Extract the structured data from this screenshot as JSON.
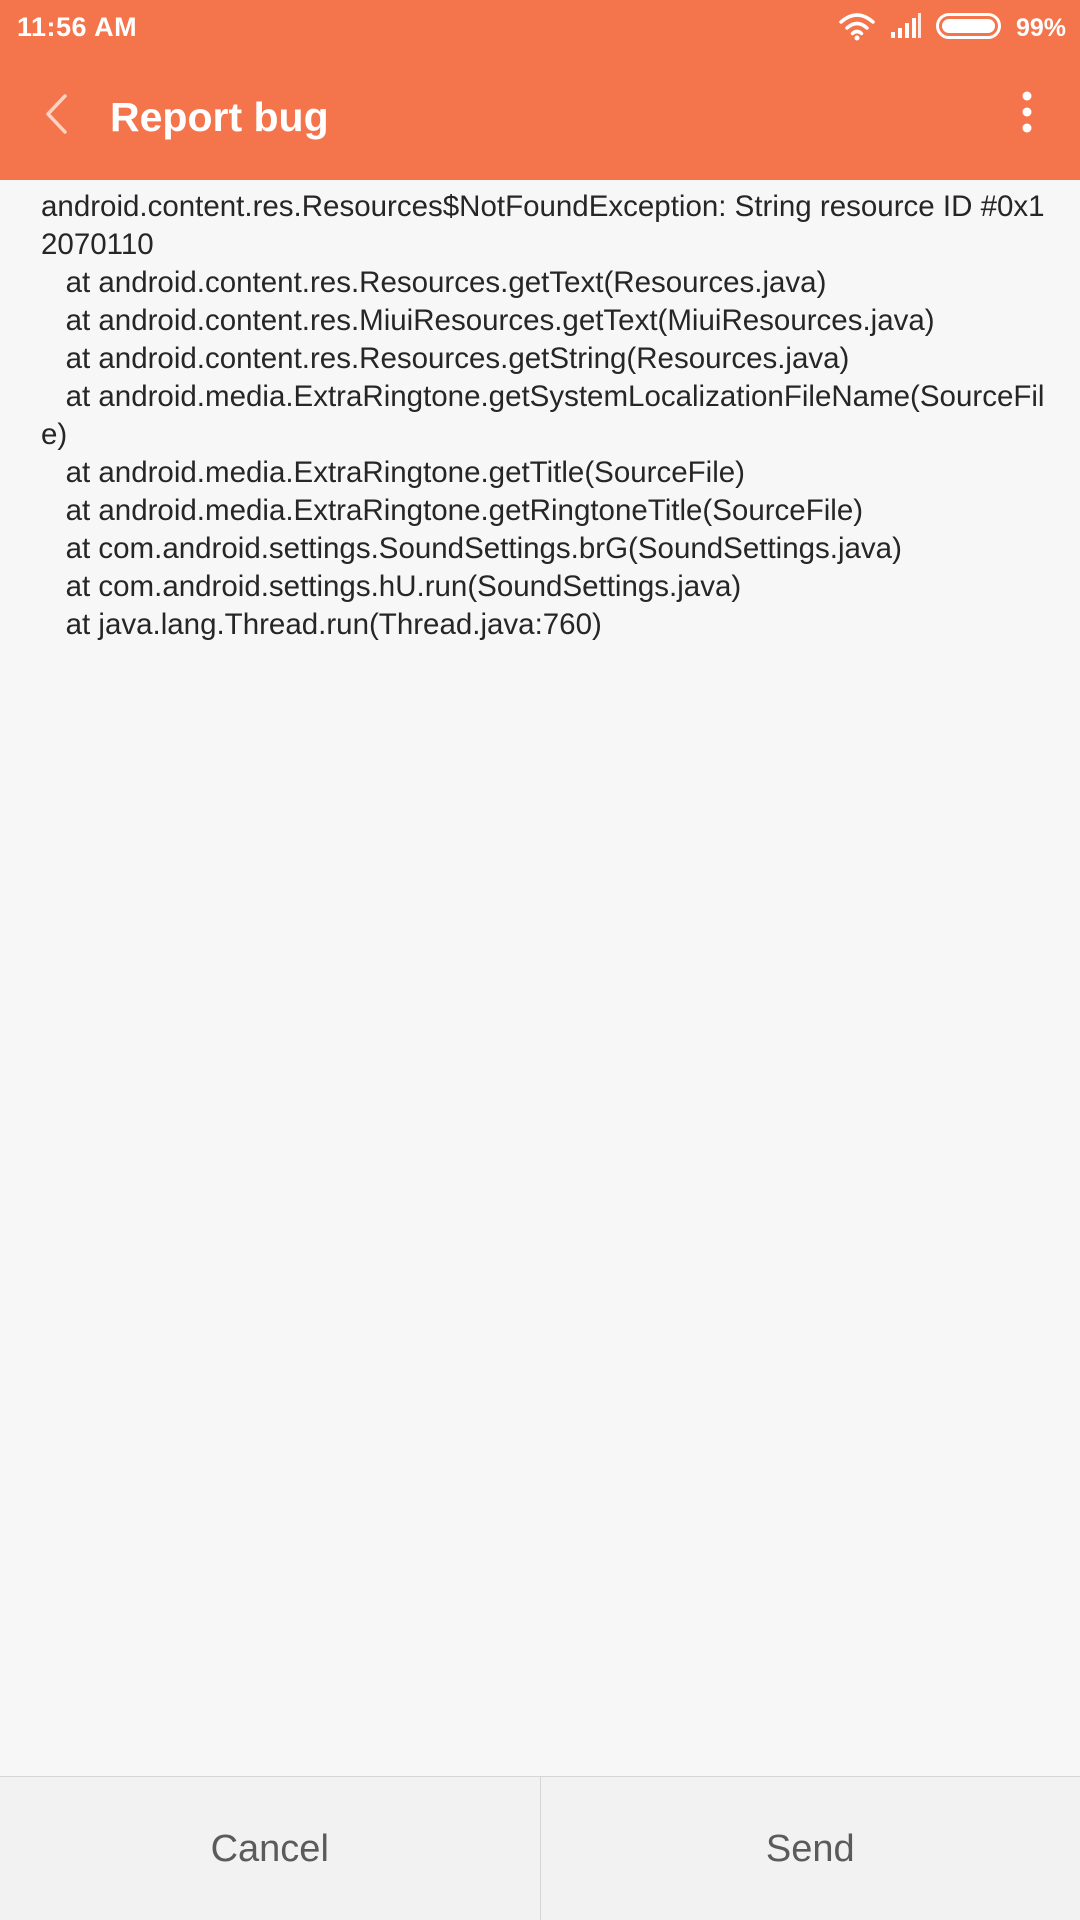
{
  "status_bar": {
    "time": "11:56 AM",
    "battery_percent": "99%",
    "battery_level": 0.99,
    "icons": [
      "wifi-icon",
      "signal-icon",
      "battery-icon"
    ]
  },
  "app_bar": {
    "title": "Report bug",
    "back_icon": "chevron-left-icon",
    "menu_icon": "more-vertical-icon",
    "color": "#f4744c"
  },
  "report": {
    "text": "android.content.res.Resources$NotFoundException: String resource ID #0x12070110\n   at android.content.res.Resources.getText(Resources.java)\n   at android.content.res.MiuiResources.getText(MiuiResources.java)\n   at android.content.res.Resources.getString(Resources.java)\n   at android.media.ExtraRingtone.getSystemLocalizationFileName(SourceFile)\n   at android.media.ExtraRingtone.getTitle(SourceFile)\n   at android.media.ExtraRingtone.getRingtoneTitle(SourceFile)\n   at com.android.settings.SoundSettings.brG(SoundSettings.java)\n   at com.android.settings.hU.run(SoundSettings.java)\n   at java.lang.Thread.run(Thread.java:760)"
  },
  "actions": {
    "cancel_label": "Cancel",
    "send_label": "Send"
  }
}
